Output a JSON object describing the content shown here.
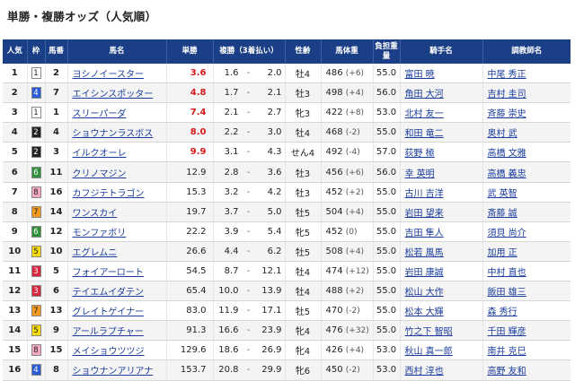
{
  "title": "単勝・複勝オッズ（人気順）",
  "headers": [
    "人気",
    "枠",
    "馬番",
    "馬名",
    "単勝",
    "複勝（3着払い）",
    "性齢",
    "馬体重",
    "負担重量",
    "騎手名",
    "調教師名"
  ],
  "gate_colors": {
    "1": {
      "bg": "#ffffff",
      "fg": "#222222"
    },
    "2": {
      "bg": "#222222",
      "fg": "#ffffff"
    },
    "3": {
      "bg": "#d7263d",
      "fg": "#ffffff"
    },
    "4": {
      "bg": "#2a5cd6",
      "fg": "#ffffff"
    },
    "5": {
      "bg": "#f5d90a",
      "fg": "#222222"
    },
    "6": {
      "bg": "#2f8f3a",
      "fg": "#ffffff"
    },
    "7": {
      "bg": "#f29a1f",
      "fg": "#222222"
    },
    "8": {
      "bg": "#f6a9c2",
      "fg": "#222222"
    }
  },
  "hot_color": "#d81a1a",
  "rows": [
    {
      "rank": "1",
      "gate": "1",
      "num": "2",
      "name": "ヨシノイースター",
      "win": "3.6",
      "hot": true,
      "plc_lo": "1.6",
      "plc_hi": "2.0",
      "sex_age": "牡4",
      "weight": "486",
      "wdiff": "(+6)",
      "burden": "55.0",
      "jockey": "富田 暁",
      "trainer": "中尾 秀正"
    },
    {
      "rank": "2",
      "gate": "4",
      "num": "7",
      "name": "エイシンスポッター",
      "win": "4.8",
      "hot": true,
      "plc_lo": "1.7",
      "plc_hi": "2.1",
      "sex_age": "牡3",
      "weight": "498",
      "wdiff": "(+4)",
      "burden": "56.0",
      "jockey": "角田 大河",
      "trainer": "吉村 圭司"
    },
    {
      "rank": "3",
      "gate": "1",
      "num": "1",
      "name": "スリーパーダ",
      "win": "7.4",
      "hot": true,
      "plc_lo": "2.1",
      "plc_hi": "2.7",
      "sex_age": "牝3",
      "weight": "422",
      "wdiff": "(+8)",
      "burden": "53.0",
      "jockey": "北村 友一",
      "trainer": "斉藤 崇史"
    },
    {
      "rank": "4",
      "gate": "2",
      "num": "4",
      "name": "ショウナンラスボス",
      "win": "8.0",
      "hot": true,
      "plc_lo": "2.2",
      "plc_hi": "3.0",
      "sex_age": "牡4",
      "weight": "468",
      "wdiff": "(-2)",
      "burden": "55.0",
      "jockey": "和田 竜二",
      "trainer": "奥村 武"
    },
    {
      "rank": "5",
      "gate": "2",
      "num": "3",
      "name": "イルクオーレ",
      "win": "9.9",
      "hot": true,
      "plc_lo": "3.1",
      "plc_hi": "4.3",
      "sex_age": "せん4",
      "weight": "492",
      "wdiff": "(-4)",
      "burden": "57.0",
      "jockey": "荻野 極",
      "trainer": "高橋 文雅"
    },
    {
      "rank": "6",
      "gate": "6",
      "num": "11",
      "name": "クリノマジン",
      "win": "12.9",
      "hot": false,
      "plc_lo": "2.8",
      "plc_hi": "3.6",
      "sex_age": "牡3",
      "weight": "456",
      "wdiff": "(+6)",
      "burden": "56.0",
      "jockey": "幸 英明",
      "trainer": "高橋 義忠"
    },
    {
      "rank": "7",
      "gate": "8",
      "num": "16",
      "name": "カフジテトラゴン",
      "win": "15.3",
      "hot": false,
      "plc_lo": "3.2",
      "plc_hi": "4.2",
      "sex_age": "牡3",
      "weight": "452",
      "wdiff": "(+2)",
      "burden": "55.0",
      "jockey": "古川 吉洋",
      "trainer": "武 英智"
    },
    {
      "rank": "8",
      "gate": "7",
      "num": "14",
      "name": "ワンスカイ",
      "win": "19.7",
      "hot": false,
      "plc_lo": "3.7",
      "plc_hi": "5.0",
      "sex_age": "牡5",
      "weight": "504",
      "wdiff": "(+4)",
      "burden": "55.0",
      "jockey": "岩田 望来",
      "trainer": "斎藤 誠"
    },
    {
      "rank": "9",
      "gate": "6",
      "num": "12",
      "name": "モンファボリ",
      "win": "22.2",
      "hot": false,
      "plc_lo": "3.9",
      "plc_hi": "5.4",
      "sex_age": "牝5",
      "weight": "452",
      "wdiff": "(0)",
      "burden": "55.0",
      "jockey": "吉田 隼人",
      "trainer": "須貝 尚介"
    },
    {
      "rank": "10",
      "gate": "5",
      "num": "10",
      "name": "エグレムニ",
      "win": "26.6",
      "hot": false,
      "plc_lo": "4.4",
      "plc_hi": "6.2",
      "sex_age": "牡5",
      "weight": "508",
      "wdiff": "(+4)",
      "burden": "55.0",
      "jockey": "松若 風馬",
      "trainer": "加用 正"
    },
    {
      "rank": "11",
      "gate": "3",
      "num": "5",
      "name": "フォイアーロート",
      "win": "54.5",
      "hot": false,
      "plc_lo": "8.7",
      "plc_hi": "12.1",
      "sex_age": "牡4",
      "weight": "474",
      "wdiff": "(+12)",
      "burden": "55.0",
      "jockey": "岩田 康誠",
      "trainer": "中村 直也"
    },
    {
      "rank": "12",
      "gate": "3",
      "num": "6",
      "name": "テイエムイダテン",
      "win": "65.4",
      "hot": false,
      "plc_lo": "10.0",
      "plc_hi": "13.9",
      "sex_age": "牡4",
      "weight": "488",
      "wdiff": "(+2)",
      "burden": "55.0",
      "jockey": "松山 大作",
      "trainer": "飯田 雄三"
    },
    {
      "rank": "13",
      "gate": "7",
      "num": "13",
      "name": "グレイトゲイナー",
      "win": "83.0",
      "hot": false,
      "plc_lo": "11.9",
      "plc_hi": "17.1",
      "sex_age": "牡5",
      "weight": "470",
      "wdiff": "(-2)",
      "burden": "55.0",
      "jockey": "松本 大輝",
      "trainer": "森 秀行"
    },
    {
      "rank": "14",
      "gate": "5",
      "num": "9",
      "name": "アールラプチャー",
      "win": "91.3",
      "hot": false,
      "plc_lo": "16.6",
      "plc_hi": "23.9",
      "sex_age": "牝4",
      "weight": "476",
      "wdiff": "(+32)",
      "burden": "55.0",
      "jockey": "竹之下 智昭",
      "trainer": "千田 輝彦"
    },
    {
      "rank": "15",
      "gate": "8",
      "num": "15",
      "name": "メイショウツツジ",
      "win": "129.6",
      "hot": false,
      "plc_lo": "18.6",
      "plc_hi": "26.9",
      "sex_age": "牝4",
      "weight": "426",
      "wdiff": "(+4)",
      "burden": "53.0",
      "jockey": "秋山 真一郎",
      "trainer": "南井 克巳"
    },
    {
      "rank": "16",
      "gate": "4",
      "num": "8",
      "name": "ショウナンアリアナ",
      "win": "153.7",
      "hot": false,
      "plc_lo": "20.8",
      "plc_hi": "29.9",
      "sex_age": "牝6",
      "weight": "450",
      "wdiff": "(-2)",
      "burden": "53.0",
      "jockey": "西村 淳也",
      "trainer": "高野 友和"
    }
  ]
}
